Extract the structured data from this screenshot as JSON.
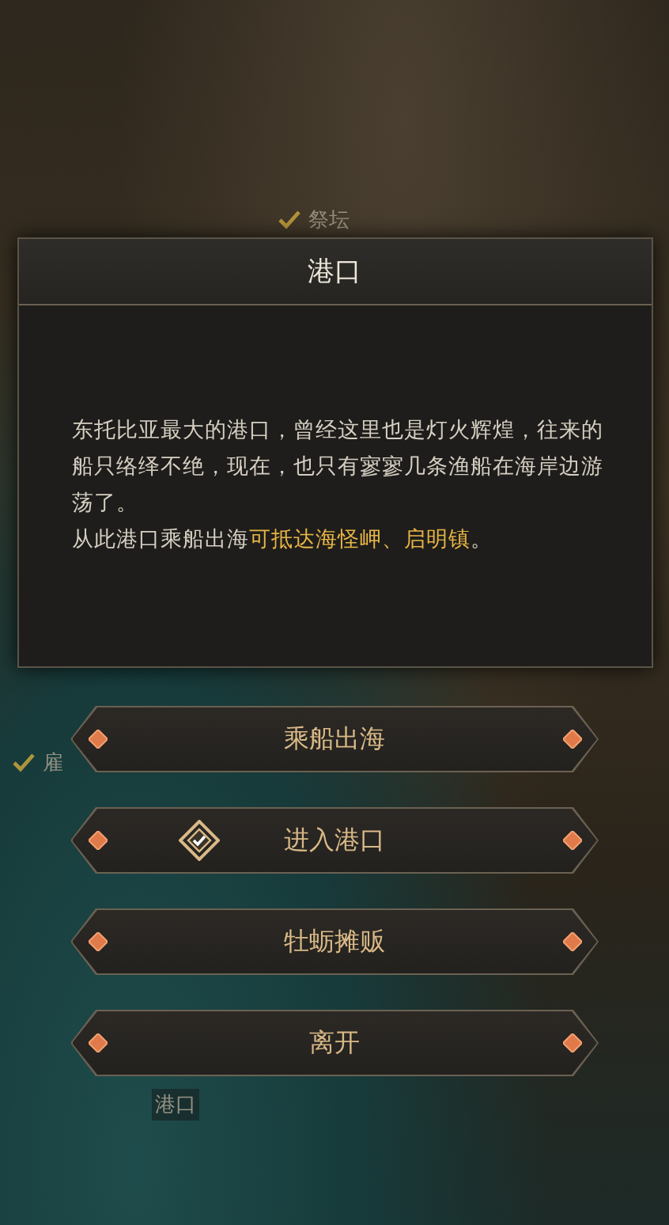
{
  "map_labels": [
    {
      "text": "祭坛",
      "checked": true
    },
    {
      "text": "雇",
      "checked": true
    },
    {
      "text": "港口",
      "checked": false
    }
  ],
  "dialog": {
    "title": "港口",
    "paragraphs": [
      {
        "parts": [
          {
            "text": "东托比亚最大的港口，曾经这里也是灯火辉煌，往来的船只络绎不绝，现在，也只有寥寥几条渔船在海岸边游荡了。",
            "highlight": false
          }
        ]
      },
      {
        "parts": [
          {
            "text": "从此港口乘船出海",
            "highlight": false
          },
          {
            "text": "可抵达海怪岬、启明镇",
            "highlight": true
          },
          {
            "text": "。",
            "highlight": false
          }
        ]
      }
    ]
  },
  "options": [
    {
      "label": "乘船出海",
      "visited": false
    },
    {
      "label": "进入港口",
      "visited": true
    },
    {
      "label": "牡蛎摊贩",
      "visited": false
    },
    {
      "label": "离开",
      "visited": false
    }
  ]
}
